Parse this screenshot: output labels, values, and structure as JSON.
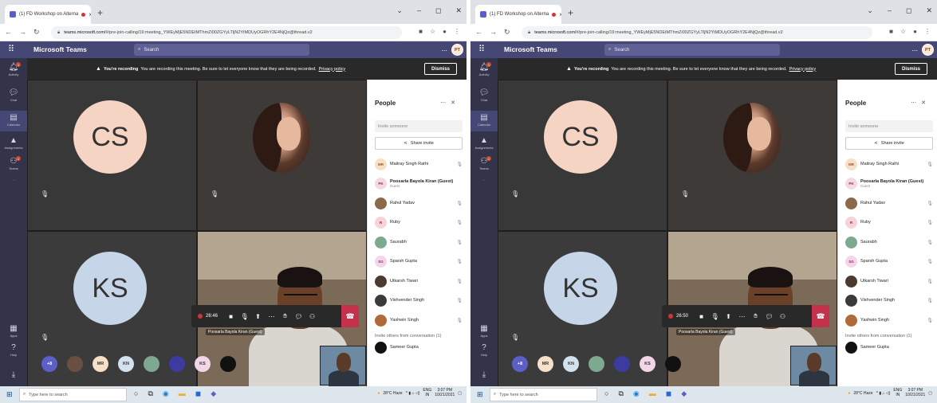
{
  "browser": {
    "tab_title": "(1) FD Workshop on Alterna",
    "tab_close": "×",
    "new_tab": "+",
    "url_domain": "teams.microsoft.com/",
    "url_path": "#/pre-join-calling/19:meeting_YWEyMjE5NDEtMThmZi00ZGYyLTljN2YtMDUyOGRhY2E4NjQz@thread.v2"
  },
  "teams": {
    "brand": "Microsoft Teams",
    "search_placeholder": "Search",
    "more": "...",
    "me_initials": "PT"
  },
  "rail": [
    {
      "label": "Activity",
      "icon": "bell-icon"
    },
    {
      "label": "Chat",
      "icon": "chat-icon"
    },
    {
      "label": "Calendar",
      "icon": "calendar-icon"
    },
    {
      "label": "Assignments",
      "icon": "assignments-icon"
    },
    {
      "label": "Teams",
      "icon": "teams-icon"
    },
    {
      "label": "...",
      "icon": "more-icon"
    },
    {
      "label": "Apps",
      "icon": "apps-icon"
    },
    {
      "label": "Help",
      "icon": "help-icon"
    }
  ],
  "banner": {
    "bold": "You're recording",
    "text": "You are recording this meeting. Be sure to let everyone know that they are being recorded.",
    "link": "Privacy policy",
    "dismiss": "Dismiss"
  },
  "tiles": {
    "cs": "CS",
    "ks": "KS",
    "presenter_name": "Poosarla Bayola Kiran (Guest)"
  },
  "strip": [
    "+8",
    "MR",
    "KN",
    "KS"
  ],
  "callbars": {
    "left_time": "26:46",
    "right_time": "26:50"
  },
  "people": {
    "title": "People",
    "invite_placeholder": "Invite someone",
    "share": "Share invite",
    "guest_label": "Guest",
    "list": [
      {
        "initials": "MR",
        "name": "Maitray Singh Rathi",
        "color": "#f7e0c8"
      },
      {
        "initials": "PK",
        "name": "Poosarla Bayola Kiran (Guest)",
        "color": "#f5d9e0"
      },
      {
        "initials": "",
        "name": "Rahul Yadav",
        "color": "#8a6a4a"
      },
      {
        "initials": "R",
        "name": "Ruby",
        "color": "#f7d3d9"
      },
      {
        "initials": "",
        "name": "Saurabh",
        "color": "#7fa890"
      },
      {
        "initials": "SG",
        "name": "Sparsh Gupta",
        "color": "#f3d6e8"
      },
      {
        "initials": "",
        "name": "Utkarsh Tiwari",
        "color": "#4a3a30"
      },
      {
        "initials": "",
        "name": "Vishvender Singh",
        "color": "#3a3a3a"
      },
      {
        "initials": "",
        "name": "Yashwin Singh",
        "color": "#b06a3a"
      }
    ],
    "others": "Invite others from conversation (1)",
    "sameer": "Sameer Gupta"
  },
  "taskbar": {
    "search": "Type here to search",
    "weather": "28°C Haze",
    "lang_top": "ENG",
    "lang_bottom": "IN",
    "time_left": "3:07 PM",
    "time_right": "3:07 PM",
    "date": "10/21/2021"
  }
}
